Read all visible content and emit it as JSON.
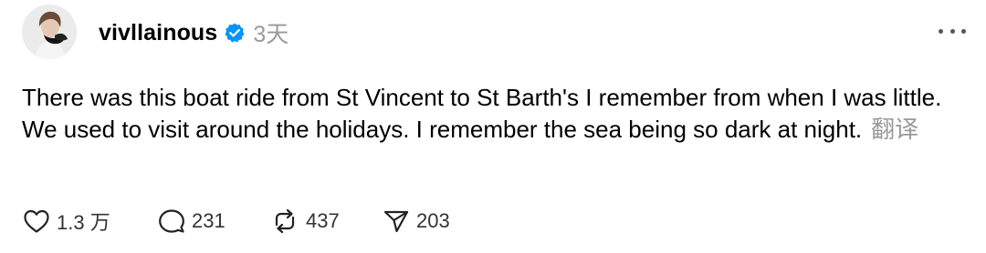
{
  "post": {
    "author": {
      "username": "vivllainous",
      "verified_icon": "verified-badge-icon",
      "time": "3天"
    },
    "text": "There was this boat ride from St Vincent to St Barth's I remember from when I was little. We used to visit around the holidays. I remember the sea being so dark at night.",
    "translate_label": "翻译",
    "menu_icon": "more-dots-icon",
    "actions": {
      "like": {
        "icon": "heart-icon",
        "count": "1.3 万"
      },
      "reply": {
        "icon": "comment-bubble-icon",
        "count": "231"
      },
      "repost": {
        "icon": "repost-arrows-icon",
        "count": "437"
      },
      "share": {
        "icon": "send-paper-plane-icon",
        "count": "203"
      }
    }
  },
  "colors": {
    "verified": "#0095f6",
    "secondary_text": "#999999",
    "icon": "#222222"
  }
}
